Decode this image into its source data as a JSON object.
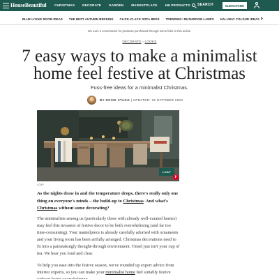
{
  "header": {
    "logo": "HouseBeautiful",
    "nav": [
      "CHRISTMAS",
      "DECORATE",
      "GARDEN",
      "MARKETPLACE",
      "HB PRODUCTS"
    ],
    "search_label": "SEARCH",
    "subscribe_label": "SUBSCRIBE",
    "brand_color": "#1f5a50",
    "icons": [
      "hamburger-icon",
      "search-icon",
      "account-icon"
    ]
  },
  "trending": [
    "BLUE LIVING ROOM IDEAS",
    "THE BEST AUTUMN BEDDING",
    "CLICK-CLACK SOFA BEDS",
    "TRENDING: MUSHROOM LAMPS",
    "HALLWAY COLOUR IDEAS"
  ],
  "commission_note": "We earn a commission for products purchased through some links in this article.",
  "category": {
    "primary": "DECORATE",
    "separator": "›",
    "secondary": "LOOKS"
  },
  "article": {
    "headline": "7 easy ways to make a minimalist home feel festive at Christmas",
    "subheadline": "Fuss-free ideas for a minimalist Christmas.",
    "author": "BY ROSIE STAGG",
    "separator": "|",
    "updated": "UPDATED: 26 OCTOBER 2023",
    "hero_badge": "LOAF",
    "hero_caption": "LOAF",
    "p1_before": "As the nights draw in and the temperature drops, there's really only one thing on everyone's minds – the build-up to ",
    "p1_link1": "Christmas",
    "p1_middle": ". And what's ",
    "p1_link2": "Christmas",
    "p1_after": " without some decorating?",
    "p2": "The minimalists among us (particularly those with already well-curated homes) may feel this invasion of festive decor to be both overwhelming (and far too time-consuming). Your mantelpiece is already carefully adorned with ornaments and your living room has been artfully arranged. Christmas decorations need to fit into a painstakingly thought-through environment. Tinsel just isn't your cup of tea. We hear you loud and clear.",
    "p3_before": "To help you ease into the festive season, we've rounded up expert advice from interior experts, so you can make your ",
    "p3_link": "minimalist home",
    "p3_after": " feel suitably festive without being overwhelming."
  }
}
